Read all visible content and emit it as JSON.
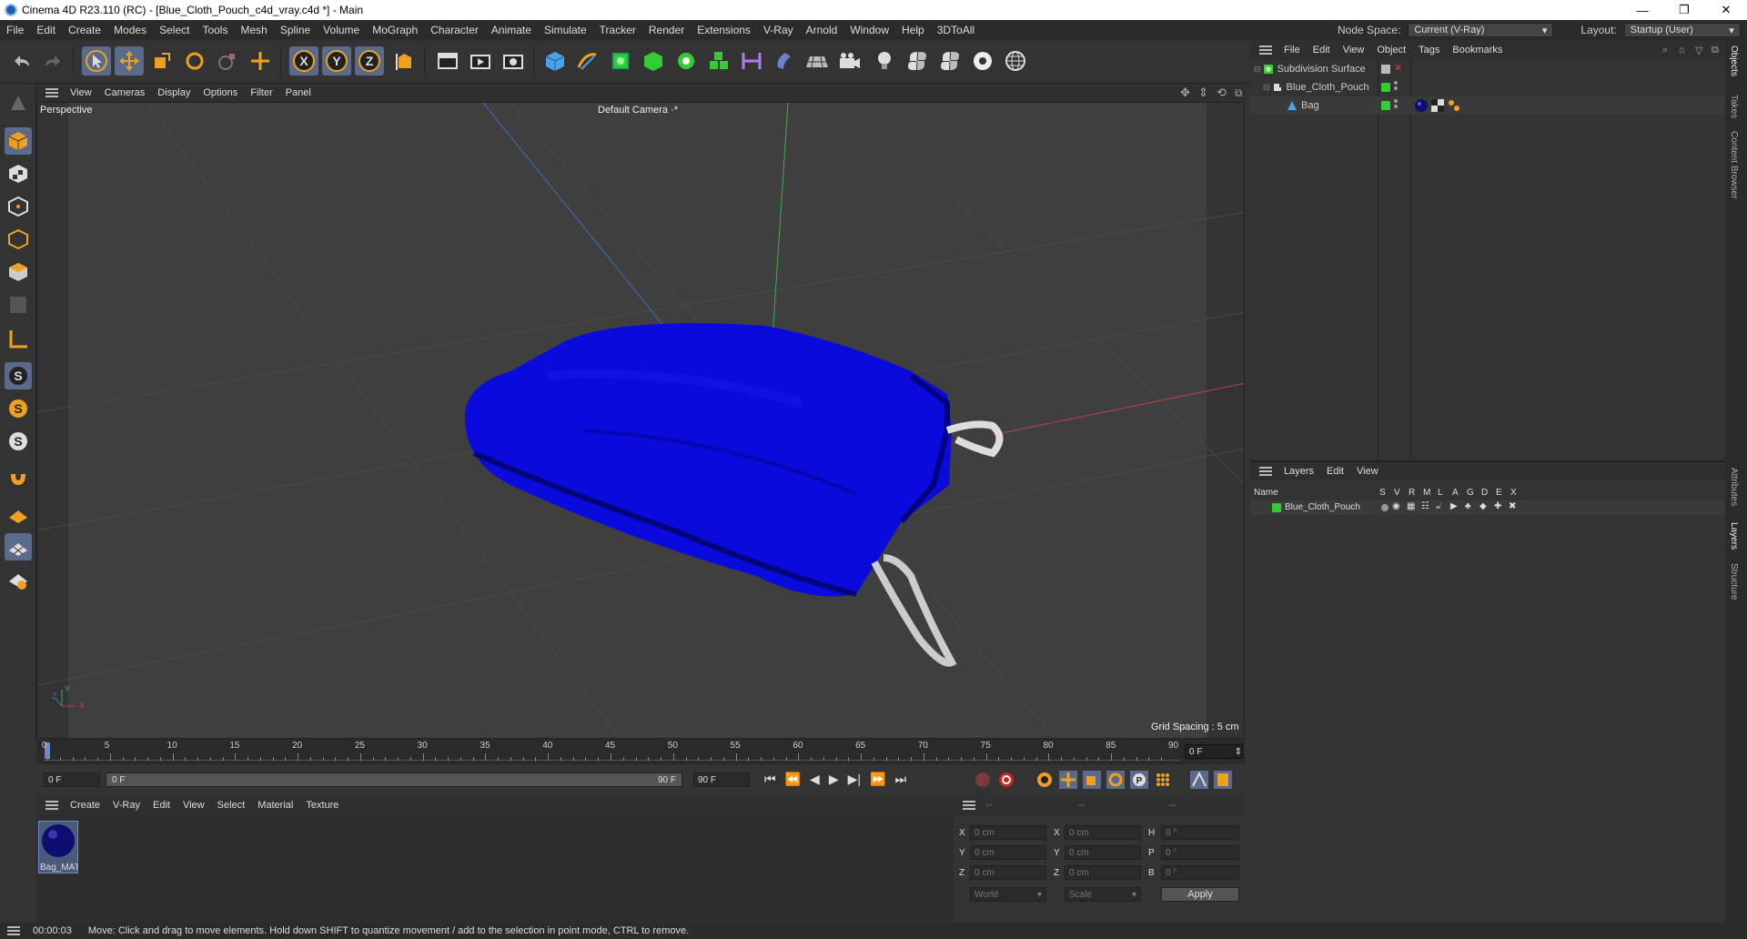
{
  "app": {
    "title": "Cinema 4D R23.110 (RC) - [Blue_Cloth_Pouch_c4d_vray.c4d *] - Main",
    "minimize": "—",
    "maximize": "❐",
    "close": "✕"
  },
  "menu": [
    "File",
    "Edit",
    "Create",
    "Modes",
    "Select",
    "Tools",
    "Mesh",
    "Spline",
    "Volume",
    "MoGraph",
    "Character",
    "Animate",
    "Simulate",
    "Tracker",
    "Render",
    "Extensions",
    "V-Ray",
    "Arnold",
    "Window",
    "Help",
    "3DToAll"
  ],
  "nodespace": {
    "label": "Node Space:",
    "value": "Current (V-Ray)",
    "layout_label": "Layout:",
    "layout_value": "Startup (User)"
  },
  "viewport": {
    "menu": [
      "View",
      "Cameras",
      "Display",
      "Options",
      "Filter",
      "Panel"
    ],
    "name": "Perspective",
    "camera": "Default Camera",
    "grid_spacing": "Grid Spacing : 5 cm",
    "axis_y": "Y",
    "axis_z": "Z",
    "axis_x": "X"
  },
  "timeline": {
    "ticks": [
      "0",
      "5",
      "10",
      "15",
      "20",
      "25",
      "30",
      "35",
      "40",
      "45",
      "50",
      "55",
      "60",
      "65",
      "70",
      "75",
      "80",
      "85",
      "90"
    ],
    "current": "0 F"
  },
  "transport": {
    "start": "0 F",
    "range_start": "0 F",
    "range_end": "90 F",
    "end": "90 F"
  },
  "material_manager": {
    "menu": [
      "Create",
      "V-Ray",
      "Edit",
      "View",
      "Select",
      "Material",
      "Texture"
    ],
    "materials": [
      {
        "name": "Bag_MAT"
      }
    ]
  },
  "coords": {
    "headers": [
      "--",
      "--",
      "--"
    ],
    "rows": [
      {
        "a": "X",
        "av": "0 cm",
        "b": "X",
        "bv": "0 cm",
        "c": "H",
        "cv": "0 °"
      },
      {
        "a": "Y",
        "av": "0 cm",
        "b": "Y",
        "bv": "0 cm",
        "c": "P",
        "cv": "0 °"
      },
      {
        "a": "Z",
        "av": "0 cm",
        "b": "Z",
        "bv": "0 cm",
        "c": "B",
        "cv": "0 °"
      }
    ],
    "world": "World",
    "scale": "Scale",
    "apply": "Apply"
  },
  "objects": {
    "menu": [
      "File",
      "Edit",
      "View",
      "Object",
      "Tags",
      "Bookmarks"
    ],
    "items": [
      {
        "name": "Subdivision Surface"
      },
      {
        "name": "Blue_Cloth_Pouch"
      },
      {
        "name": "Bag"
      }
    ]
  },
  "layers": {
    "menu": [
      "Layers",
      "Edit",
      "View"
    ],
    "header_name": "Name",
    "header_cols": [
      "S",
      "V",
      "R",
      "M",
      "L",
      "A",
      "G",
      "D",
      "E",
      "X"
    ],
    "items": [
      {
        "name": "Blue_Cloth_Pouch"
      }
    ]
  },
  "sidetabs": [
    "Objects",
    "Takes",
    "Content Browser",
    "Attributes",
    "Layers",
    "Structure"
  ],
  "status": {
    "time": "00:00:03",
    "message": "Move: Click and drag to move elements. Hold down SHIFT to quantize movement / add to the selection in point mode, CTRL to remove."
  },
  "colors": {
    "accent": "#f0a020",
    "layer_green": "#33cc33",
    "cloth_blue": "#0a0adc"
  }
}
